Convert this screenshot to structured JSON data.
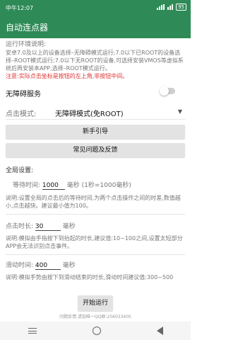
{
  "status": {
    "time": "中午12:07",
    "battery": "95"
  },
  "app": {
    "title": "自动连点器"
  },
  "env": {
    "title": "运行环境说明:",
    "desc": "安卓7.0及以上的设备选择–无障碍模式运行;7.0以下已ROOT的设备选择–ROOT模式运行;7.0以下无ROOT的设备,可选择安装VMOS等虚拟系统后再安装本APP,选择–ROOT模式运行。",
    "warning": "注意:实际点击坐标是按钮的左上角,非按钮中间。"
  },
  "accessibility": {
    "label": "无障碍服务",
    "enabled": false
  },
  "click_mode": {
    "label": "点击模式:",
    "selected": "无障碍模式(免ROOT)"
  },
  "buttons": {
    "guide": "新手引导",
    "faq": "常见问题及反馈",
    "start": "开始运行"
  },
  "global": {
    "title": "全局设置:",
    "wait_label": "等待时间:",
    "wait_value": "1000",
    "wait_unit": "毫秒 (1秒=1000毫秒)",
    "wait_desc": "说明:设置全局的点击后的等待时间,为两个点击操作之间的时差,数值越小,点击越快。建议最小值为100。"
  },
  "click_duration": {
    "label": "点击时长:",
    "value": "30",
    "unit": "毫秒",
    "desc": "说明:模拟由手指按下到抬起的时长,建议值:10~100之间,设置太短部分APP会无法识别点击事件。"
  },
  "swipe_duration": {
    "label": "滑动时间:",
    "value": "400",
    "unit": "毫秒",
    "desc": "说明:模拟手势由按下到滑动结束的时长,滑动时间建议值:300~500"
  },
  "footer": {
    "text": "问题反馈,请加唯一QQ群:256033405"
  }
}
